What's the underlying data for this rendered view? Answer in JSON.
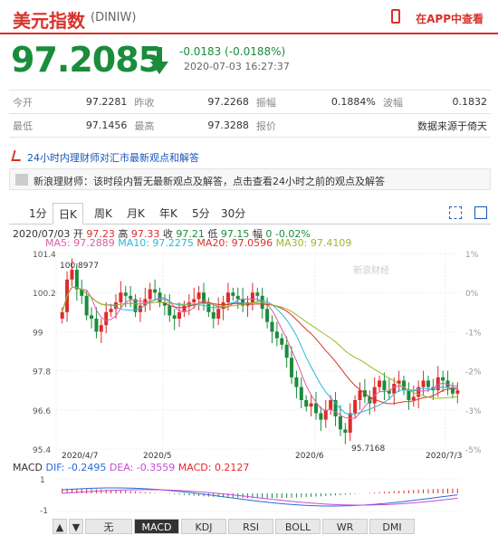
{
  "header": {
    "name": "美元指数",
    "code": "(DINIW)",
    "app_link": "在APP中查看"
  },
  "quote": {
    "price": "97.2085",
    "change": "-0.0183 (-0.0188%)",
    "time": "2020-07-03 16:27:37",
    "rows": [
      [
        {
          "l": "今开",
          "v": "97.2281"
        },
        {
          "l": "昨收",
          "v": "97.2268"
        },
        {
          "l": "振幅",
          "v": "0.1884%"
        },
        {
          "l": "波幅",
          "v": "0.1832"
        }
      ],
      [
        {
          "l": "最低",
          "v": "97.1456"
        },
        {
          "l": "最高",
          "v": "97.3288"
        },
        {
          "l": "报价",
          "v": "数据来源于倚天"
        }
      ]
    ]
  },
  "news": {
    "headline": "24小时内理财师对汇市最新观点和解答",
    "item": "新浪理财师：该时段内暂无最新观点及解答，点击查看24小时之前的观点及解答"
  },
  "tabs": [
    "1分",
    "日K",
    "周K",
    "月K",
    "年K",
    "5分",
    "30分"
  ],
  "chart_info": {
    "date": "2020/07/03",
    "open_l": "开",
    "open": "97.23",
    "high_l": "高",
    "high": "97.33",
    "close_l": "收",
    "close": "97.21",
    "low_l": "低",
    "low": "97.15",
    "chg_l": "幅",
    "chg": "0 -0.02%",
    "ma5": "MA5: 97.2889",
    "ma10": "MA10: 97.2275",
    "ma20": "MA20: 97.0596",
    "ma30": "MA30: 97.4109"
  },
  "chart_labels": {
    "y_left": [
      "101.4",
      "100.2",
      "99",
      "97.8",
      "96.6",
      "95.4"
    ],
    "y_right": [
      "1%",
      "0%",
      "-1%",
      "-2%",
      "-3%",
      "-5%"
    ],
    "x": [
      "2020/4/7",
      "2020/5",
      "2020/6",
      "2020/7/3"
    ],
    "max_mark": "100.8977",
    "min_mark": "95.7168",
    "watermark": "新浪财经"
  },
  "macd": {
    "label": "MACD",
    "dif": "DIF: -0.2495",
    "dea": "DEA: -0.3559",
    "macd": "MACD: 0.2127",
    "y": [
      "1",
      "-1"
    ]
  },
  "bottom_tabs": [
    "▲",
    "▼",
    "无",
    "MACD",
    "KDJ",
    "RSI",
    "BOLL",
    "WR",
    "DMI"
  ],
  "colors": {
    "up": "#e02a2a",
    "down": "#1a8c3c",
    "ma5": "#e05aa8",
    "ma10": "#2ab8d8",
    "ma20": "#d8322a",
    "ma30": "#9bb82a"
  },
  "chart_data": {
    "type": "candlestick",
    "ylim": [
      95.4,
      101.4
    ],
    "closes": [
      99.6,
      100.6,
      100.9,
      100.3,
      100.1,
      99.5,
      99.4,
      99.0,
      99.2,
      99.6,
      99.7,
      99.9,
      100.2,
      100.1,
      100.0,
      99.6,
      99.8,
      100.0,
      100.3,
      100.2,
      99.9,
      99.8,
      99.5,
      99.4,
      99.6,
      99.8,
      99.9,
      100.0,
      100.2,
      99.9,
      99.6,
      99.4,
      99.7,
      99.9,
      100.2,
      100.1,
      100.0,
      99.8,
      99.9,
      100.2,
      100.1,
      99.7,
      99.3,
      99.0,
      98.8,
      98.6,
      98.2,
      97.6,
      97.3,
      96.9,
      96.7,
      96.8,
      96.5,
      96.3,
      96.6,
      96.9,
      96.4,
      96.0,
      95.9,
      96.5,
      96.9,
      97.2,
      97.0,
      96.8,
      97.3,
      97.5,
      97.2,
      97.1,
      97.4,
      97.5,
      97.2,
      96.9,
      97.0,
      97.3,
      97.5,
      97.3,
      97.2,
      97.6,
      97.5,
      97.3,
      97.1,
      97.2
    ]
  }
}
